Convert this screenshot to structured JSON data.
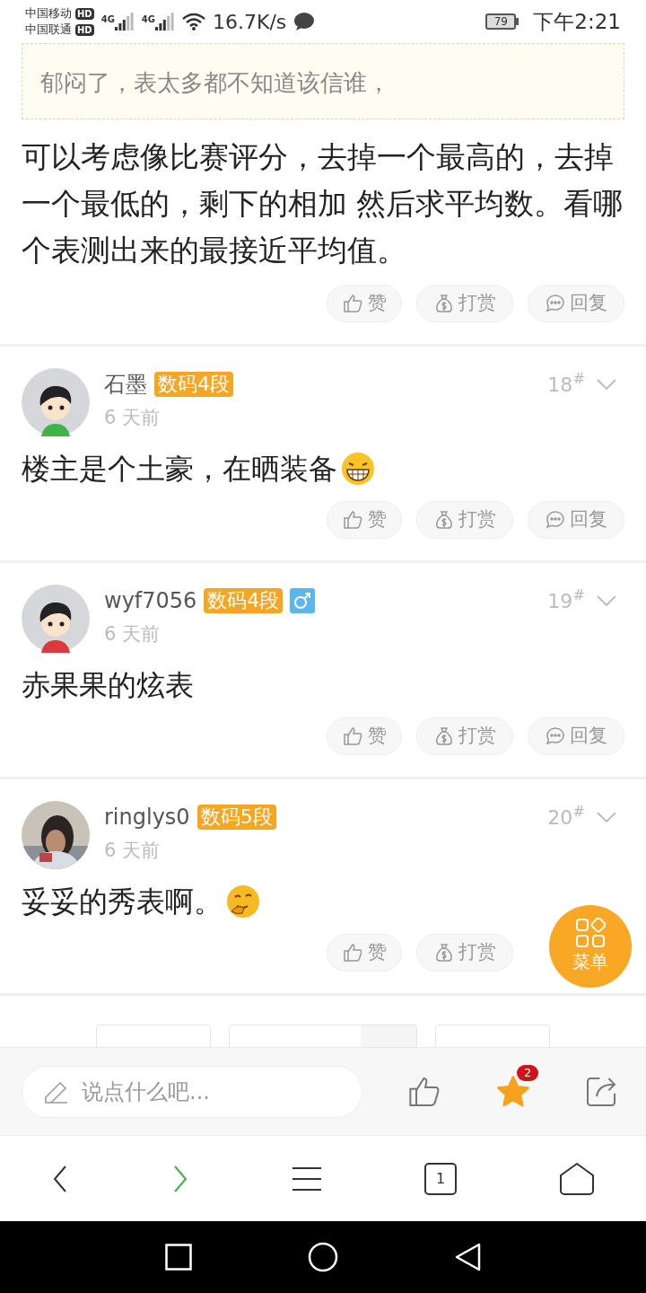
{
  "status_bar": {
    "carriers": [
      {
        "name": "中国移动",
        "badge": "HD"
      },
      {
        "name": "中国联通",
        "badge": "HD"
      }
    ],
    "networks": [
      "4G",
      "4G"
    ],
    "speed": "16.7K/s",
    "battery": "79",
    "time": "下午2:21"
  },
  "quote": {
    "text": "郁闷了，表太多都不知道该信谁，"
  },
  "top_post": {
    "text": "可以考虑像比赛评分，去掉一个最高的，去掉一个最低的，剩下的相加 然后求平均数。看哪个表测出来的最接近平均值。",
    "actions": [
      {
        "kind": "like",
        "label": "赞"
      },
      {
        "kind": "reward",
        "label": "打赏"
      },
      {
        "kind": "reply",
        "label": "回复"
      }
    ]
  },
  "comments": [
    {
      "avatar": {
        "kind": "cartoon",
        "color": "#3fb24a"
      },
      "name": "石墨",
      "badge": "数码4段",
      "time": "6 天前",
      "floor": "18$^{#}$",
      "text": "楼主是个土豪，在晒装备",
      "emoji": {
        "kind": "grin"
      },
      "actions": [
        {
          "kind": "like",
          "label": "赞"
        },
        {
          "kind": "reward",
          "label": "打赏"
        },
        {
          "kind": "reply",
          "label": "回复"
        }
      ]
    },
    {
      "avatar": {
        "kind": "cartoon",
        "color": "#e0383a"
      },
      "name": "wyf7056",
      "badge": "数码4段",
      "gender_icon": {
        "kind": "male"
      },
      "time": "6 天前",
      "floor": "19$^{#}$",
      "text": "赤果果的炫表",
      "actions": [
        {
          "kind": "like",
          "label": "赞"
        },
        {
          "kind": "reward",
          "label": "打赏"
        },
        {
          "kind": "reply",
          "label": "回复"
        }
      ]
    },
    {
      "avatar": {
        "kind": "picture"
      },
      "name": "ringlys0",
      "badge": "数码5段",
      "time": "6 天前",
      "floor": "20$^{#}$",
      "text": "妥妥的秀表啊。",
      "emoji": {
        "kind": "smirk"
      },
      "actions": [
        {
          "kind": "like",
          "label": "赞"
        },
        {
          "kind": "reward",
          "label": "打赏"
        }
      ]
    }
  ],
  "floating_menu": {
    "label": "菜单"
  },
  "comment_bar": {
    "placeholder": "说点什么吧...",
    "favorites_count": "2"
  },
  "browser_nav": {
    "tabs_count": "1"
  }
}
